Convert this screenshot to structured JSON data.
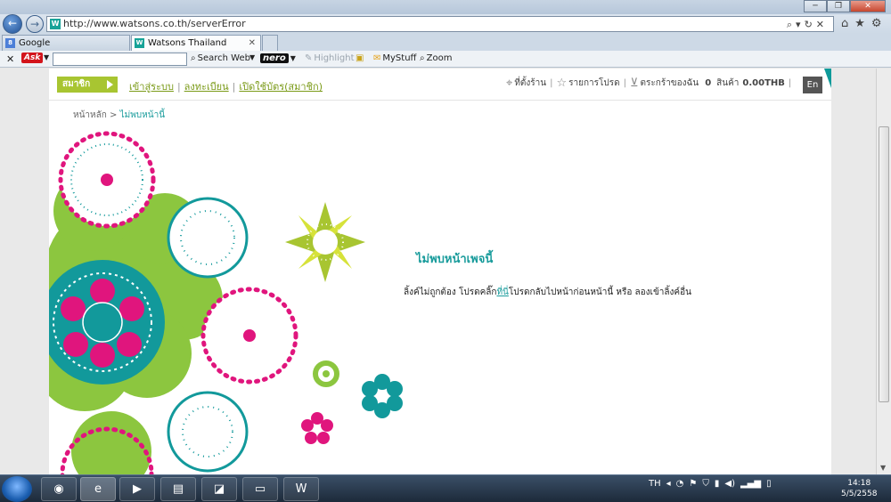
{
  "browser": {
    "url": "http://www.watsons.co.th/serverError",
    "tabs": [
      {
        "label": "Google"
      },
      {
        "label": "Watsons Thailand"
      }
    ]
  },
  "toolbar": {
    "ask_label": "Ask",
    "search_web": "Search Web",
    "nero_label": "nero",
    "highlight": "Highlight",
    "mystuff": "MyStuff",
    "zoom": "Zoom"
  },
  "site": {
    "member_badge": "สมาชิก",
    "member_links": [
      "เข้าสู่ระบบ",
      "ลงทะเบียน",
      "เปิดใช้บัตร(สมาชิก)"
    ],
    "store_locator": "ที่ตั้งร้าน",
    "wishlist": "รายการโปรด",
    "cart_label": "ตระกร้าของฉัน",
    "cart_count": "0",
    "cart_items_label": "สินค้า",
    "cart_total": "0.00THB",
    "lang": "En"
  },
  "breadcrumb": {
    "home": "หน้าหลัก",
    "separator": ">",
    "current": "ไม่พบหน้านี้"
  },
  "error": {
    "title": "ไม่พบหน้าเพจนี้",
    "msg_before": "ลิ้งค์ไม่ถูกต้อง โปรดคลิ๊ก",
    "msg_link": "ที่นี่",
    "msg_after": "โปรดกลับไปหน้าก่อนหน้านี้ หรือ ลองเข้าลิ้งค์อื่น"
  },
  "taskbar": {
    "lang_indicator": "TH",
    "time": "14:18",
    "date": "5/5/2558"
  },
  "colors": {
    "brand_teal": "#1a9c9c",
    "brand_green": "#a8c531",
    "accent_pink": "#e0157d"
  }
}
